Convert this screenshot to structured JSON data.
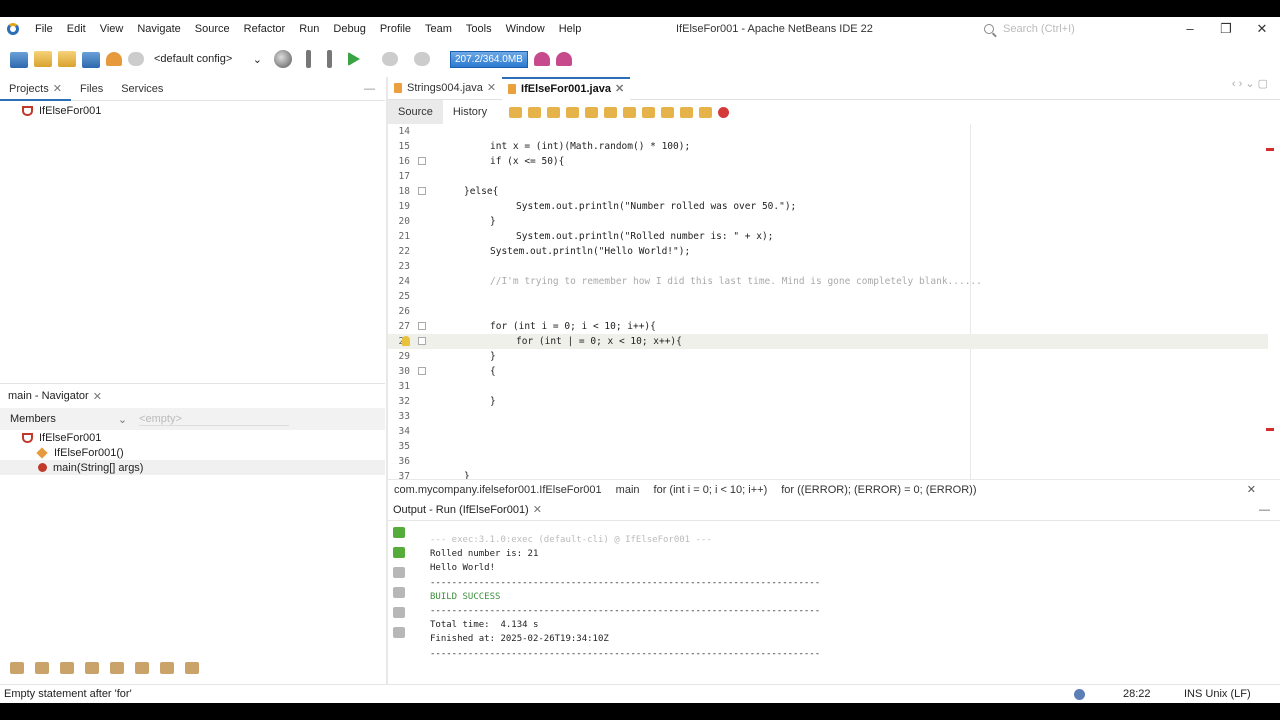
{
  "window": {
    "title": "IfElseFor001 - Apache NetBeans IDE 22",
    "search_placeholder": "Search (Ctrl+I)"
  },
  "menu": [
    "File",
    "Edit",
    "View",
    "Navigate",
    "Source",
    "Refactor",
    "Run",
    "Debug",
    "Profile",
    "Team",
    "Tools",
    "Window",
    "Help"
  ],
  "toolbar": {
    "config": "<default config>",
    "memory": "207.2/364.0MB"
  },
  "left_tabs": [
    "Projects",
    "Files",
    "Services"
  ],
  "project": {
    "name": "IfElseFor001"
  },
  "navigator": {
    "title": "main - Navigator",
    "members_label": "Members",
    "filter_placeholder": "<empty>",
    "items": [
      "IfElseFor001",
      "IfElseFor001()",
      "main(String[] args)"
    ]
  },
  "editor_tabs": [
    "Strings004.java",
    "IfElseFor001.java"
  ],
  "source_tabs": [
    "Source",
    "History"
  ],
  "code_lines": [
    {
      "n": "14",
      "t": ""
    },
    {
      "n": "15",
      "t": "int x = (int)(Math.random() * 100);"
    },
    {
      "n": "16",
      "t": "if (x <= 50){"
    },
    {
      "n": "17",
      "t": ""
    },
    {
      "n": "18",
      "t": "}else{"
    },
    {
      "n": "19",
      "t": "System.out.println(\"Number rolled was over 50.\");"
    },
    {
      "n": "20",
      "t": "}"
    },
    {
      "n": "21",
      "t": "System.out.println(\"Rolled number is: \" + x);"
    },
    {
      "n": "22",
      "t": "System.out.println(\"Hello World!\");"
    },
    {
      "n": "23",
      "t": ""
    },
    {
      "n": "24",
      "t": "//I'm trying to remember how I did this last time. Mind is gone completely blank......"
    },
    {
      "n": "25",
      "t": ""
    },
    {
      "n": "26",
      "t": ""
    },
    {
      "n": "27",
      "t": "for (int i = 0; i < 10; i++){"
    },
    {
      "n": "28",
      "t": "for (int | = 0; x < 10; x++){"
    },
    {
      "n": "29",
      "t": "}"
    },
    {
      "n": "30",
      "t": "{"
    },
    {
      "n": "31",
      "t": ""
    },
    {
      "n": "32",
      "t": "}"
    },
    {
      "n": "33",
      "t": ""
    },
    {
      "n": "34",
      "t": ""
    },
    {
      "n": "35",
      "t": ""
    },
    {
      "n": "36",
      "t": ""
    },
    {
      "n": "37",
      "t": "}"
    }
  ],
  "breadcrumb": [
    "com.mycompany.ifelsefor001.IfElseFor001",
    "main",
    "for (int i = 0; i < 10; i++)",
    "for ((ERROR); (ERROR) = 0; (ERROR))"
  ],
  "output": {
    "title": "Output - Run (IfElseFor001)",
    "lines": [
      "--- exec:3.1.0:exec (default-cli) @ IfElseFor001 ---",
      "Rolled number is: 21",
      "Hello World!",
      "------------------------------------------------------------------------",
      "BUILD SUCCESS",
      "------------------------------------------------------------------------",
      "Total time:  4.134 s",
      "Finished at: 2025-02-26T19:34:10Z",
      "------------------------------------------------------------------------"
    ]
  },
  "status": {
    "message": "Empty statement after 'for'",
    "position": "28:22",
    "mode": "INS",
    "line_ending": "Unix (LF)"
  }
}
